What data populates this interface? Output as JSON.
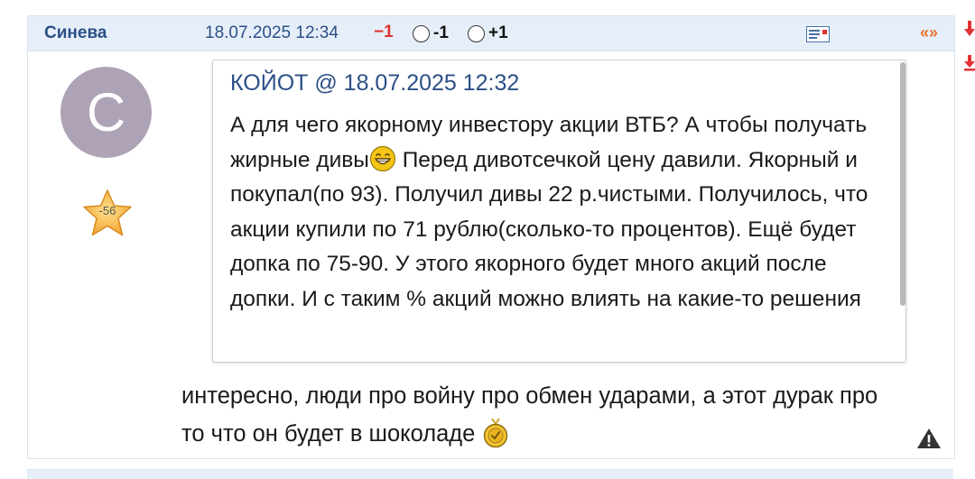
{
  "post": {
    "author": "Синева",
    "date": "18.07.2025 12:34",
    "rating": "−1",
    "vote_minus_label": "-1",
    "vote_plus_label": "+1",
    "quote_link_label": "«»",
    "avatar_letter": "С",
    "user_rating": "-56"
  },
  "quote": {
    "header": "КОЙОТ @ 18.07.2025 12:32",
    "text_before_emoji": "А для чего якорному инвестору акции ВТБ? А чтобы получать жирные дивы",
    "text_after_emoji": " Перед дивотсечкой цену давили. Якорный и покупал(по 93). Получил дивы 22 р.чистыми. Получилось, что акции купили по 71 рублю(сколько-то процентов). Ещё будет допка по 75-90. У этого якорного будет много акций после допки. И с таким % акций можно влиять на какие-то решения"
  },
  "reply": {
    "text": "интересно, люди про войну про обмен ударами, а этот дурак про то что он будет в шоколаде"
  },
  "icons": {
    "laugh": "laughing-face-emoji",
    "medal": "gold-medal-emoji",
    "report": "warning-triangle-icon",
    "message": "private-message-icon"
  },
  "colors": {
    "header_bg": "#e6eff9",
    "link_blue": "#2b4f86",
    "negative_red": "#e23232",
    "quote_arrows_orange": "#e8702a",
    "avatar_bg": "#aea2b6"
  }
}
